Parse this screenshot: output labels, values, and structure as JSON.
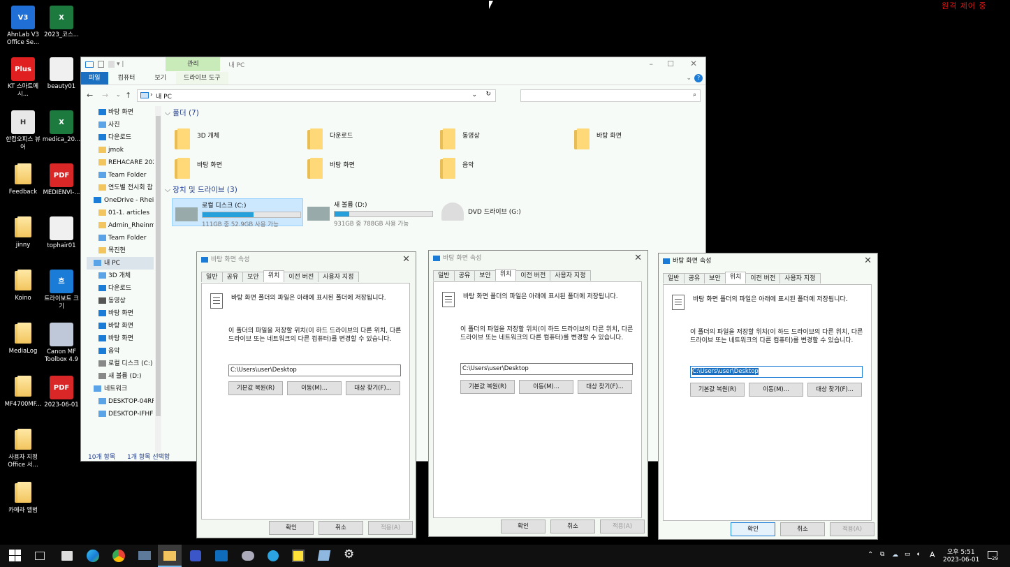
{
  "remote_label": "원격 제어 중",
  "desktop": {
    "icons": [
      {
        "label": "AhnLab V3 Office Se...",
        "color": "#1f6fd6",
        "glyph": "V3"
      },
      {
        "label": "2023_코스...",
        "color": "#1d7a3e",
        "glyph": "X"
      },
      {
        "label": "KT 스마트메시...",
        "color": "#e02020",
        "glyph": "Plus"
      },
      {
        "label": "beauty01",
        "color": "#f0f0f0",
        "glyph": ""
      },
      {
        "label": "한컴오피스 뷰어",
        "color": "#e8e8e8",
        "glyph": "H"
      },
      {
        "label": "medica_20...",
        "color": "#1d7a3e",
        "glyph": "X"
      },
      {
        "label": "Feedback",
        "color": "",
        "glyph": ""
      },
      {
        "label": "MEDIENVI-...",
        "color": "#d92626",
        "glyph": "PDF"
      },
      {
        "label": "jinny",
        "color": "",
        "glyph": ""
      },
      {
        "label": "tophair01",
        "color": "#f0f0f0",
        "glyph": ""
      },
      {
        "label": "Koino",
        "color": "",
        "glyph": ""
      },
      {
        "label": "트라이보트 크기",
        "color": "#1a7cd6",
        "glyph": "흐"
      },
      {
        "label": "MediaLog",
        "color": "",
        "glyph": ""
      },
      {
        "label": "Canon MF Toolbox 4.9",
        "color": "#bfc8d8",
        "glyph": ""
      },
      {
        "label": "MF4700MF...",
        "color": "",
        "glyph": ""
      },
      {
        "label": "2023-06-01",
        "color": "#d92626",
        "glyph": "PDF"
      },
      {
        "label": "사용자 지정 Office 서...",
        "color": "",
        "glyph": ""
      },
      {
        "label": "카메라 앨범",
        "color": "",
        "glyph": ""
      }
    ]
  },
  "explorer": {
    "title": "내 PC",
    "manage_tab": "관리",
    "tabs": [
      "파일",
      "컴퓨터",
      "보기",
      "드라이브 도구"
    ],
    "address": "내 PC",
    "nav": [
      "바탕 화면",
      "사진",
      "다운로드",
      "jmok",
      "REHACARE 2023",
      "Team Folder",
      "연도별 전시회 참",
      "OneDrive - Rhein",
      "01-1. articles",
      "Admin_Rheinme",
      "Team Folder",
      "목진현",
      "내 PC",
      "3D 개체",
      "다운로드",
      "동영상",
      "바탕 화면",
      "바탕 화면",
      "바탕 화면",
      "음악",
      "로컬 디스크 (C:)",
      "새 볼륨 (D:)",
      "네트워크",
      "DESKTOP-04RF7",
      "DESKTOP-IFHFF"
    ],
    "folders_header": "폴더 (7)",
    "folders": [
      "3D 개체",
      "다운로드",
      "동영상",
      "바탕 화면",
      "바탕 화면",
      "바탕 화면",
      "음악"
    ],
    "drives_header": "장치 및 드라이브 (3)",
    "drives": [
      {
        "name": "로컬 디스크 (C:)",
        "info": "111GB 중 52.9GB 사용 가능",
        "used": 0.52
      },
      {
        "name": "새 볼륨 (D:)",
        "info": "931GB 중 788GB 사용 가능",
        "used": 0.15
      },
      {
        "name": "DVD 드라이브 (G:)",
        "info": "",
        "used": 0
      }
    ],
    "status_items": "10개 항목",
    "status_selected": "1개 항목 선택함"
  },
  "dialog": {
    "title": "바탕 화면 속성",
    "tabs": [
      "일반",
      "공유",
      "보안",
      "위치",
      "이전 버전",
      "사용자 지정"
    ],
    "text1": "바탕 화면 폴더의 파일은 아래에 표시된 폴더에 저장됩니다.",
    "text2": "이 폴더의 파일을 저장할 위치(이 하드 드라이브의 다른 위치, 다른 드라이브 또는 네트워크의 다른 컴퓨터)를 변경할 수 있습니다.",
    "path": "C:\\Users\\user\\Desktop",
    "btn_restore": "기본값 복원(R)",
    "btn_move": "이동(M)...",
    "btn_find": "대상 찾기(F)...",
    "btn_ok": "확인",
    "btn_cancel": "취소",
    "btn_apply": "적용(A)"
  },
  "taskbar": {
    "time": "오후 5:51",
    "date": "2023-06-01",
    "ime": "A",
    "notif": "29"
  }
}
